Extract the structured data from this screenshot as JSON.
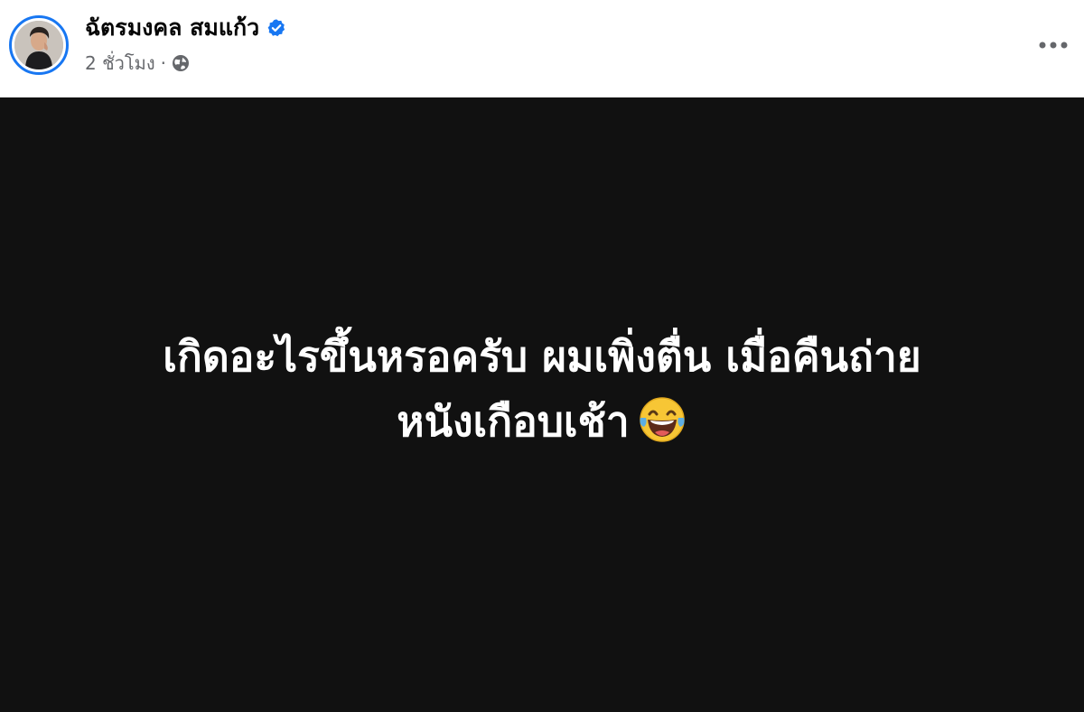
{
  "post": {
    "author": {
      "name": "ฉัตรมงคล สมแก้ว",
      "verified": true,
      "avatar_icon": "profile-photo"
    },
    "meta": {
      "time": "2 ชั่วโมง",
      "separator": "·",
      "privacy_icon": "globe-icon"
    },
    "more_icon": "more-options-icon",
    "content": {
      "line1": "เกิดอะไรขึ้นหรอครับ ผมเพิ่งตื่น เมื่อคืนถ่าย",
      "line2": "หนังเกือบเช้า",
      "emoji": "face-with-tears-of-joy",
      "background_color": "#111111",
      "text_color": "#ffffff"
    },
    "colors": {
      "accent": "#1877f2",
      "meta_text": "#65676b"
    }
  }
}
